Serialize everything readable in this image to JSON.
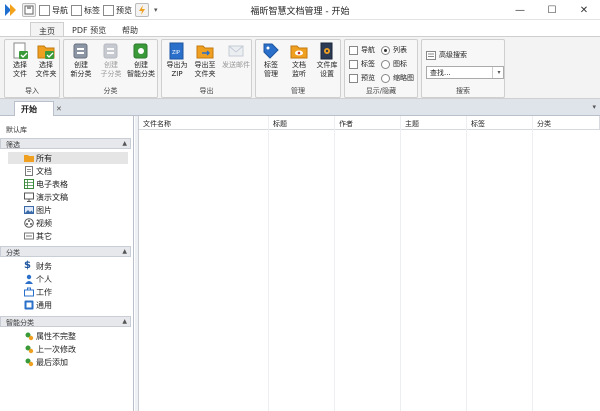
{
  "window": {
    "title": "福昕智慧文档管理 - 开始",
    "minimize": "—",
    "maximize": "☐",
    "close": "✕"
  },
  "quick_access": {
    "nav": "导航",
    "tag": "标签",
    "preview": "预览"
  },
  "ribbon_tabs": [
    "主页",
    "PDF 预览",
    "帮助"
  ],
  "ribbon": {
    "import": {
      "label": "导入",
      "buttons": [
        "选择\n文件",
        "选择\n文件夹"
      ]
    },
    "category": {
      "label": "分类",
      "buttons": [
        "创建\n新分类",
        "创建\n子分类",
        "创建\n智能分类"
      ]
    },
    "export": {
      "label": "导出",
      "buttons": [
        "导出为\nZIP",
        "导出至\n文件夹",
        "发送邮件"
      ]
    },
    "manage": {
      "label": "管理",
      "buttons": [
        "标签\n管理",
        "文档\n监听",
        "文件库\n设置"
      ]
    },
    "show_hide": {
      "label": "显示/隐藏",
      "checks": [
        "导航",
        "标签",
        "预览"
      ],
      "radios": [
        "列表",
        "图标",
        "缩略图"
      ]
    },
    "search": {
      "label": "搜索",
      "advanced": "高级搜索",
      "input_value": "查找..."
    }
  },
  "doc_tab": {
    "label": "开始",
    "close": "✕"
  },
  "left_pane": {
    "library": "默认库",
    "filter": {
      "header": "筛选",
      "items": [
        "所有",
        "文档",
        "电子表格",
        "演示文稿",
        "图片",
        "视频",
        "其它"
      ]
    },
    "category": {
      "header": "分类",
      "items": [
        "财务",
        "个人",
        "工作",
        "通用"
      ]
    },
    "smart": {
      "header": "智能分类",
      "items": [
        "属性不完整",
        "上一次修改",
        "最后添加"
      ]
    }
  },
  "grid": {
    "columns": [
      "文件名称",
      "标题",
      "作者",
      "主题",
      "标签",
      "分类"
    ]
  },
  "colors": {
    "ribbon_bg": "#f3f3f3",
    "accent_blue": "#2a6fc9",
    "folder_orange": "#f0a020"
  }
}
